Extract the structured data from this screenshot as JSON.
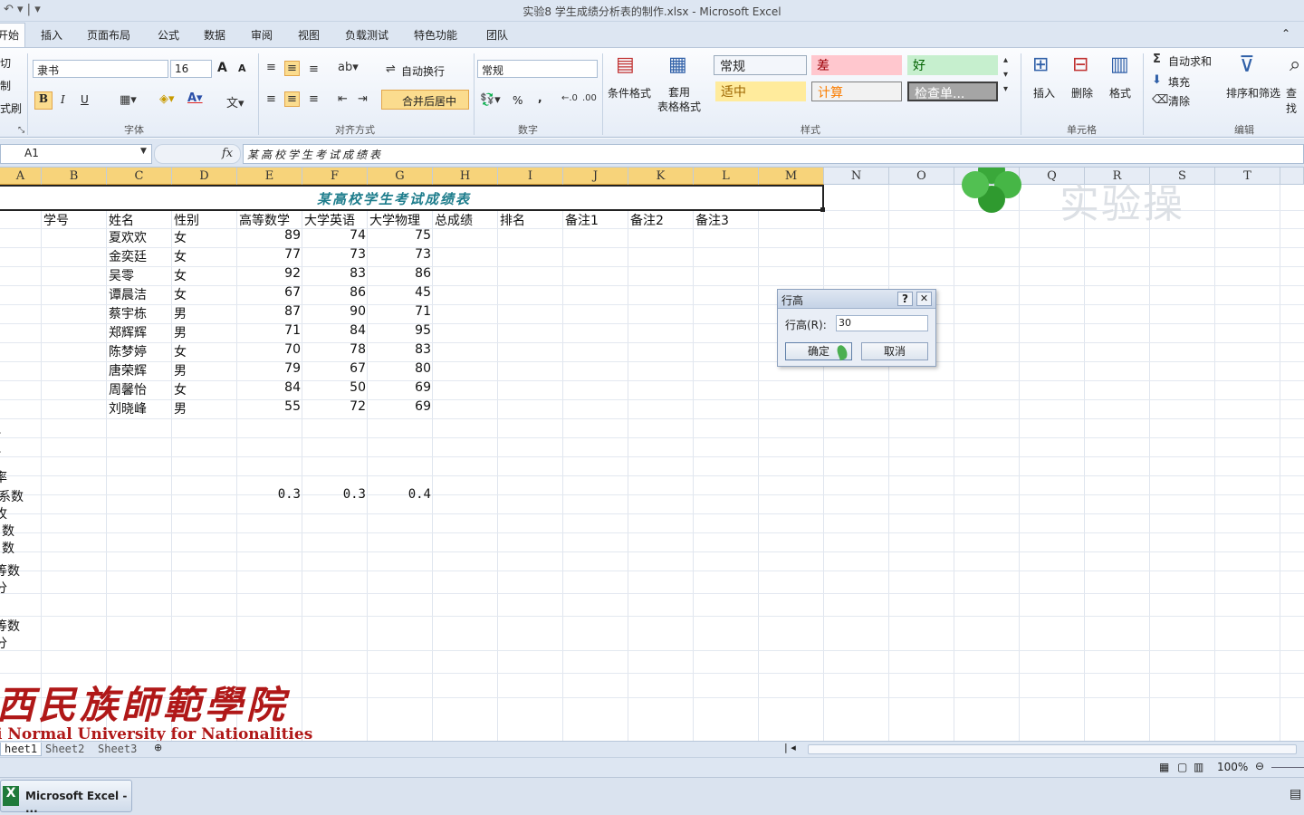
{
  "window": {
    "title": "实验8  学生成绩分析表的制作.xlsx - Microsoft Excel"
  },
  "ribbon": {
    "tabs": [
      "开始",
      "插入",
      "页面布局",
      "公式",
      "数据",
      "审阅",
      "视图",
      "负载测试",
      "特色功能",
      "团队"
    ],
    "clipboard": {
      "cut": "切",
      "copy": "制",
      "format_painter": "式刷"
    },
    "font": {
      "name": "隶书",
      "size": "16",
      "group_label": "字体",
      "bold": "B",
      "italic": "I",
      "underline": "U",
      "grow": "A",
      "shrink": "A"
    },
    "alignment": {
      "wrap": "自动换行",
      "merge": "合并后居中",
      "group_label": "对齐方式"
    },
    "number": {
      "format": "常规",
      "percent": "%",
      "comma": ",",
      "group_label": "数字"
    },
    "styles": {
      "conditional": "条件格式",
      "table_format": "套用\n表格格式",
      "normal": "常规",
      "bad": "差",
      "good": "好",
      "neutral": "适中",
      "calculation": "计算",
      "check": "检查单...",
      "group_label": "样式"
    },
    "cells": {
      "insert": "插入",
      "delete": "删除",
      "format": "格式",
      "group_label": "单元格"
    },
    "editing": {
      "autosum": "自动求和",
      "fill": "填充",
      "clear": "清除",
      "sort": "排序和筛选",
      "find": "查找",
      "group_label": "编辑"
    }
  },
  "formula_bar": {
    "name_box": "A1",
    "fx": "fx",
    "content": "某高校学生考试成绩表"
  },
  "columns": [
    "A",
    "B",
    "C",
    "D",
    "E",
    "F",
    "G",
    "H",
    "I",
    "J",
    "K",
    "L",
    "M",
    "N",
    "O",
    "P",
    "Q",
    "R",
    "S",
    "T"
  ],
  "sheet": {
    "title": "某高校学生考试成绩表",
    "headers": [
      "学号",
      "姓名",
      "性别",
      "高等数学",
      "大学英语",
      "大学物理",
      "总成绩",
      "排名",
      "备注1",
      "备注2",
      "备注3"
    ],
    "rows": [
      {
        "name": "夏欢欢",
        "gender": "女",
        "math": "89",
        "english": "74",
        "physics": "75"
      },
      {
        "name": "金奕廷",
        "gender": "女",
        "math": "77",
        "english": "73",
        "physics": "73"
      },
      {
        "name": "吴零",
        "gender": "女",
        "math": "92",
        "english": "83",
        "physics": "86"
      },
      {
        "name": "谭晨洁",
        "gender": "女",
        "math": "67",
        "english": "86",
        "physics": "45"
      },
      {
        "name": "蔡宇栋",
        "gender": "男",
        "math": "87",
        "english": "90",
        "physics": "71"
      },
      {
        "name": "郑辉辉",
        "gender": "男",
        "math": "71",
        "english": "84",
        "physics": "95"
      },
      {
        "name": "陈梦婷",
        "gender": "女",
        "math": "70",
        "english": "78",
        "physics": "83"
      },
      {
        "name": "唐荣辉",
        "gender": "男",
        "math": "79",
        "english": "67",
        "physics": "80"
      },
      {
        "name": "周馨怡",
        "gender": "女",
        "math": "84",
        "english": "50",
        "physics": "69"
      },
      {
        "name": "刘晓峰",
        "gender": "男",
        "math": "55",
        "english": "72",
        "physics": "69"
      }
    ],
    "stat_labels": [
      "、",
      "、",
      "、",
      "率",
      "系数",
      "牧",
      "数",
      "数",
      "等数",
      "分",
      "等数",
      "分"
    ],
    "coef_values": {
      "math": "0.3",
      "english": "0.3",
      "physics": "0.4"
    }
  },
  "watermark": {
    "text": "实验操",
    "school_cn": "西民族師範學院",
    "school_en": "i Normal University for Nationalities"
  },
  "sheet_tabs": [
    "heet1",
    "Sheet2",
    "Sheet3"
  ],
  "status_bar": {
    "zoom": "100%"
  },
  "taskbar": {
    "item": "Microsoft Excel - ..."
  },
  "dialog": {
    "title": "行高",
    "help": "?",
    "close": "✕",
    "label": "行高(R):",
    "value": "30",
    "ok": "确定",
    "cancel": "取消"
  },
  "colors": {
    "title_text": "#1e7d8c",
    "ribbon_bg": "#dde6f2",
    "selected_header": "#f7d37a",
    "watermark_red": "#b01818"
  }
}
